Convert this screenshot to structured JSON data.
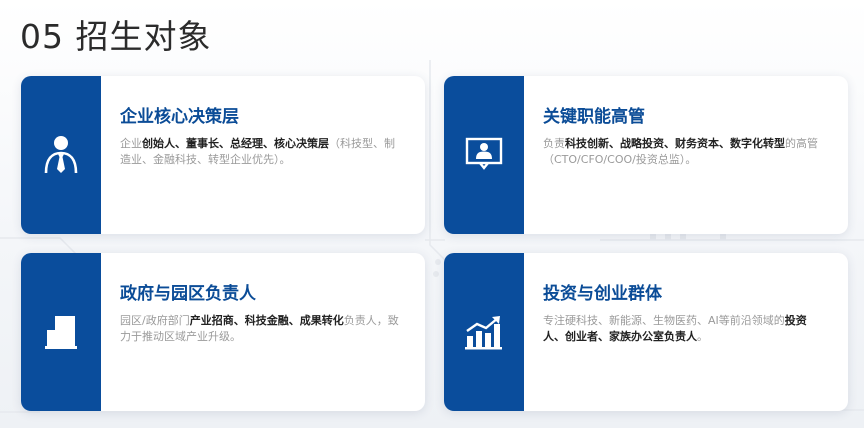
{
  "title": "05 招生对象",
  "cards": [
    {
      "heading": "企业核心决策层",
      "icon": "person-tie-icon",
      "desc": [
        {
          "t": "企业",
          "b": false
        },
        {
          "t": "创始人、董事长、总经理、核心决策层",
          "b": true
        },
        {
          "t": "（科技型、制造业、金融科技、转型企业优先）。",
          "b": false
        }
      ]
    },
    {
      "heading": "关键职能高管",
      "icon": "presentation-board-icon",
      "desc": [
        {
          "t": "负责",
          "b": false
        },
        {
          "t": "科技创新、战略投资、财务资本、数字化转型",
          "b": true
        },
        {
          "t": "的高管（CTO/CFO/COO/投资总监）。",
          "b": false
        }
      ]
    },
    {
      "heading": "政府与园区负责人",
      "icon": "building-icon",
      "desc": [
        {
          "t": "园区/政府部门",
          "b": false
        },
        {
          "t": "产业招商、科技金融、成果转化",
          "b": true
        },
        {
          "t": "负责人，致力于推动区域产业升级。",
          "b": false
        }
      ]
    },
    {
      "heading": "投资与创业群体",
      "icon": "growth-chart-icon",
      "desc": [
        {
          "t": "专注硬科技、新能源、生物医药、AI等前沿领域的",
          "b": false
        },
        {
          "t": "投资人、创业者、家族办公室负责人",
          "b": true
        },
        {
          "t": "。",
          "b": false
        }
      ]
    }
  ],
  "colors": {
    "accent": "#0a4d9c",
    "heading": "#0b4c97",
    "muted": "#9a9a9a"
  }
}
